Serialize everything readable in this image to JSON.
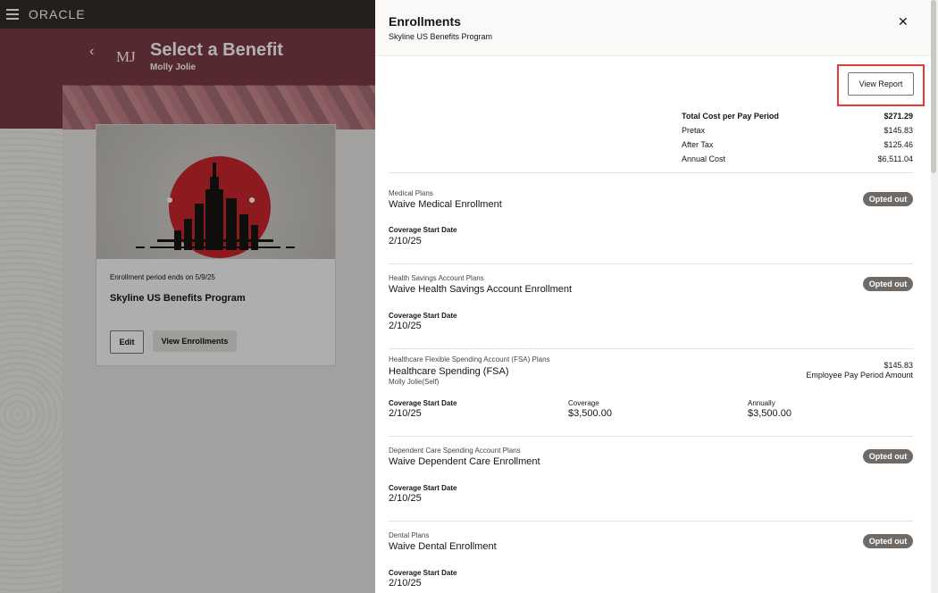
{
  "app": {
    "logo": "ORACLE"
  },
  "header": {
    "back": "‹",
    "initials": "MJ",
    "title": "Select a Benefit",
    "user": "Molly Jolie"
  },
  "card": {
    "enrollment_ends": "Enrollment period ends on 5/9/25",
    "program_name": "Skyline US Benefits Program",
    "edit_label": "Edit",
    "view_enrollments_label": "View Enrollments"
  },
  "drawer": {
    "title": "Enrollments",
    "subtitle": "Skyline US Benefits Program",
    "close": "✕",
    "view_report_label": "View Report",
    "costs": [
      {
        "label": "Total Cost per Pay Period",
        "value": "$271.29"
      },
      {
        "label": "Pretax",
        "value": "$145.83"
      },
      {
        "label": "After Tax",
        "value": "$125.46"
      },
      {
        "label": "Annual Cost",
        "value": "$6,511.04"
      }
    ],
    "plans": [
      {
        "category": "Medical Plans",
        "name": "Waive Medical Enrollment",
        "badge": "Opted out",
        "start_label": "Coverage Start Date",
        "start": "2/10/25"
      },
      {
        "category": "Health Savings Account Plans",
        "name": "Waive Health Savings Account Enrollment",
        "badge": "Opted out",
        "start_label": "Coverage Start Date",
        "start": "2/10/25"
      },
      {
        "category": "Healthcare Flexible Spending Account (FSA) Plans",
        "name": "Healthcare Spending (FSA)",
        "person": "Molly Jolie(Self)",
        "amount": "$145.83",
        "amount_label": "Employee Pay Period Amount",
        "start_label": "Coverage Start Date",
        "start": "2/10/25",
        "coverage_label": "Coverage",
        "coverage": "$3,500.00",
        "annually_label": "Annually",
        "annually": "$3,500.00"
      },
      {
        "category": "Dependent Care Spending Account Plans",
        "name": "Waive Dependent Care Enrollment",
        "badge": "Opted out",
        "start_label": "Coverage Start Date",
        "start": "2/10/25"
      },
      {
        "category": "Dental Plans",
        "name": "Waive Dental Enrollment",
        "badge": "Opted out",
        "start_label": "Coverage Start Date",
        "start": "2/10/25"
      }
    ]
  }
}
